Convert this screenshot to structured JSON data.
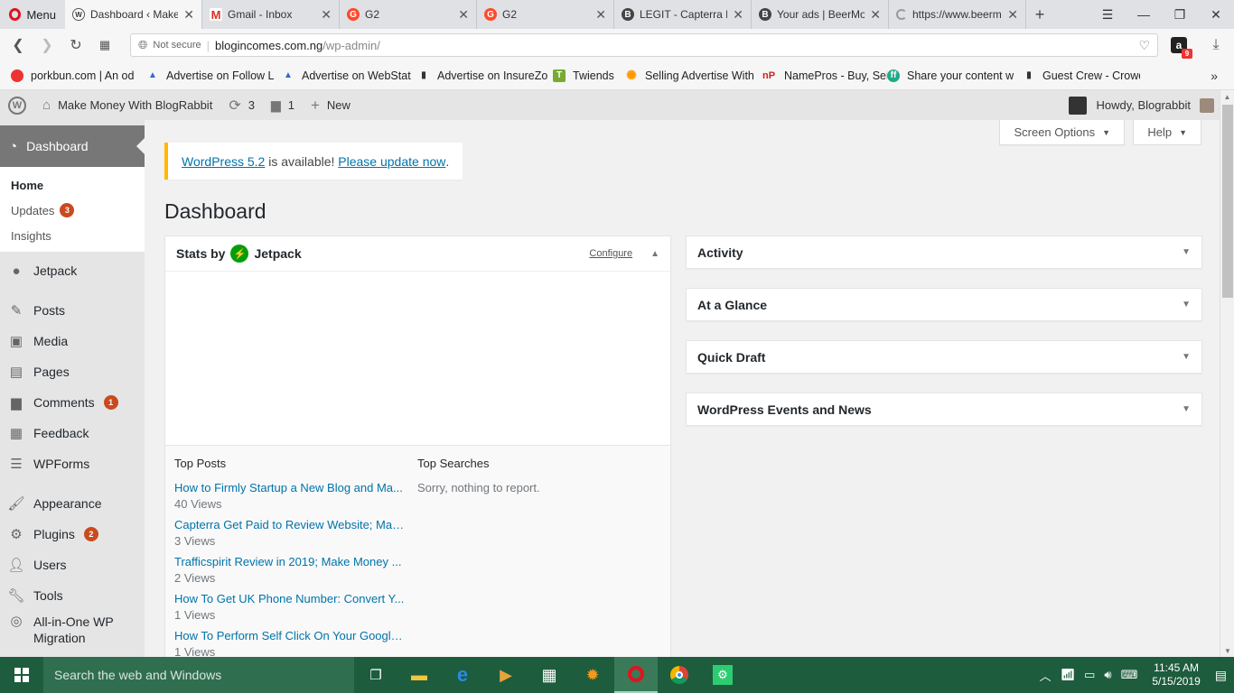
{
  "browser": {
    "menu_label": "Menu",
    "tabs": [
      {
        "label": "Dashboard ‹ Make",
        "icon": "wordpress-icon",
        "active": true
      },
      {
        "label": "Gmail - Inbox",
        "icon": "gmail-icon",
        "active": false
      },
      {
        "label": "G2",
        "icon": "g2-icon",
        "active": false
      },
      {
        "label": "G2",
        "icon": "g2-icon",
        "active": false
      },
      {
        "label": "LEGIT - Capterra Re",
        "icon": "b-icon",
        "active": false
      },
      {
        "label": "Your ads | BeerMo",
        "icon": "b-icon",
        "active": false
      },
      {
        "label": "https://www.beerm",
        "icon": "loading-icon",
        "active": false
      }
    ],
    "address": {
      "security": "Not secure",
      "host": "blogincomes.com.ng",
      "path": "/wp-admin/"
    },
    "extension_badge": "9",
    "bookmarks": [
      "porkbun.com | An od",
      "Advertise on Follow L",
      "Advertise on WebStat",
      "Advertise on InsureZo",
      "Twiends",
      "Selling Advertise With",
      "NamePros - Buy, Sell",
      "Share your content w",
      "Guest Crew - Crowd S"
    ]
  },
  "adminbar": {
    "site_name": "Make Money With BlogRabbit",
    "updates_count": "3",
    "comments_count": "1",
    "new_label": "New",
    "howdy": "Howdy, Blograbbit"
  },
  "sidebar": {
    "current": "Dashboard",
    "submenu": [
      {
        "label": "Home",
        "badge": ""
      },
      {
        "label": "Updates",
        "badge": "3"
      },
      {
        "label": "Insights",
        "badge": ""
      }
    ],
    "items": [
      {
        "label": "Jetpack",
        "badge": ""
      },
      {
        "label": "Posts",
        "badge": ""
      },
      {
        "label": "Media",
        "badge": ""
      },
      {
        "label": "Pages",
        "badge": ""
      },
      {
        "label": "Comments",
        "badge": "1"
      },
      {
        "label": "Feedback",
        "badge": ""
      },
      {
        "label": "WPForms",
        "badge": ""
      },
      {
        "label": "Appearance",
        "badge": ""
      },
      {
        "label": "Plugins",
        "badge": "2"
      },
      {
        "label": "Users",
        "badge": ""
      },
      {
        "label": "Tools",
        "badge": ""
      },
      {
        "label": "All-in-One WP Migration",
        "badge": ""
      }
    ]
  },
  "main": {
    "screen_options": "Screen Options",
    "help": "Help",
    "notice": {
      "link1": "WordPress 5.2",
      "middle": " is available! ",
      "link2": "Please update now",
      "end": "."
    },
    "title": "Dashboard",
    "stats": {
      "title_prefix": "Stats by",
      "brand": "Jetpack",
      "configure": "Configure",
      "top_posts_heading": "Top Posts",
      "top_searches_heading": "Top Searches",
      "top_searches_empty": "Sorry, nothing to report.",
      "top_posts": [
        {
          "title": "How to Firmly Startup a New Blog and Ma...",
          "views": "40 Views"
        },
        {
          "title": "Capterra Get Paid to Review Website; Mak...",
          "views": "3 Views"
        },
        {
          "title": "Trafficspirit Review in 2019; Make Money ...",
          "views": "2 Views"
        },
        {
          "title": "How To Get UK Phone Number: Convert Y...",
          "views": "1 Views"
        },
        {
          "title": "How To Perform Self Click On Your Google...",
          "views": "1 Views"
        }
      ]
    },
    "widgets": [
      "Activity",
      "At a Glance",
      "Quick Draft",
      "WordPress Events and News"
    ]
  },
  "taskbar": {
    "search_placeholder": "Search the web and Windows",
    "time": "11:45 AM",
    "date": "5/15/2019"
  }
}
